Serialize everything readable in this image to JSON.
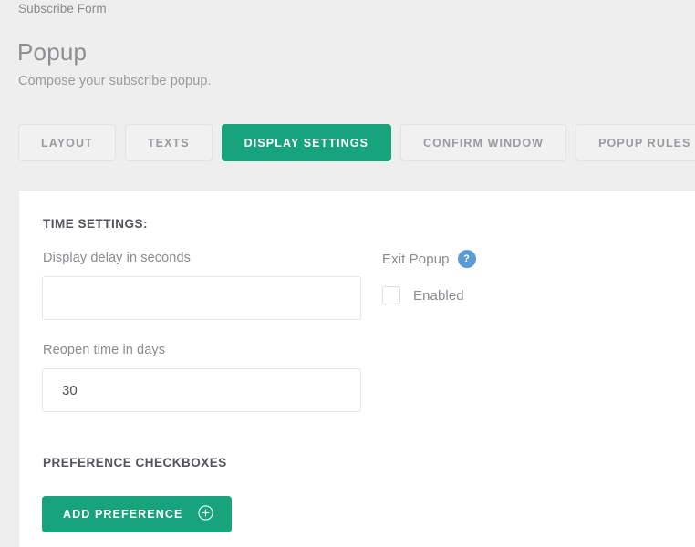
{
  "breadcrumb": {
    "label": "Subscribe Form"
  },
  "header": {
    "title": "Popup",
    "subtitle": "Compose your subscribe popup."
  },
  "tabs": [
    {
      "label": "LAYOUT",
      "active": false
    },
    {
      "label": "TEXTS",
      "active": false
    },
    {
      "label": "DISPLAY SETTINGS",
      "active": true
    },
    {
      "label": "CONFIRM WINDOW",
      "active": false
    },
    {
      "label": "POPUP RULES",
      "active": false
    }
  ],
  "time_settings": {
    "section_title": "TIME SETTINGS:",
    "delay": {
      "label": "Display delay in seconds",
      "value": "",
      "placeholder": ""
    },
    "reopen": {
      "label": "Reopen time in days",
      "value": "30",
      "placeholder": ""
    }
  },
  "exit_popup": {
    "label": "Exit Popup",
    "help_icon": "question-mark-icon",
    "help_glyph": "?",
    "enabled_label": "Enabled",
    "enabled_checked": false
  },
  "preferences": {
    "section_title": "PREFERENCE CHECKBOXES",
    "add_button_label": "ADD PREFERENCE",
    "add_button_icon": "plus-circle-icon"
  },
  "colors": {
    "accent_green": "#17a37c",
    "help_blue": "#5b9bd5",
    "page_background": "#eeeeef",
    "card_background": "#ffffff",
    "muted_text": "#8b8b90"
  }
}
